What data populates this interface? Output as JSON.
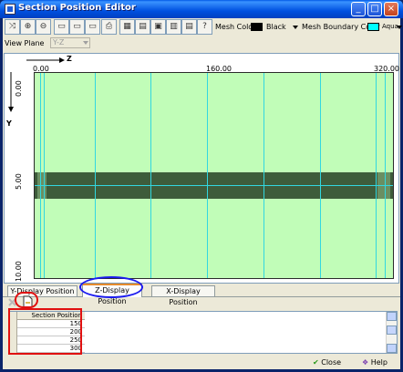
{
  "window": {
    "title": "Section Position Editor"
  },
  "toolbar": {
    "mesh_color_label": "Mesh Color",
    "mesh_color_value": "Black",
    "mesh_color_hex": "#000000",
    "boundary_color_label": "Mesh Boundary Color",
    "boundary_color_value": "Aqua",
    "boundary_color_hex": "#00ffff",
    "icons": [
      "pointer-icon",
      "zoom-in-icon",
      "zoom-out-icon",
      "zoom-fit-icon",
      "view-a-icon",
      "view-b-icon",
      "print-icon",
      "view-c-icon",
      "view-d-icon",
      "view-e-icon",
      "view-f-icon",
      "view-g-icon",
      "export-icon",
      "help-icon"
    ]
  },
  "view_plane": {
    "label": "View Plane",
    "value": "Y-Z"
  },
  "canvas": {
    "z_axis_label": "Z",
    "y_axis_label": "Y",
    "z_ticks": [
      "0.00",
      "160.00",
      "320.00"
    ],
    "y_ticks": [
      "0.00",
      "5.00",
      "10.00"
    ],
    "fill_color": "#c1fdb8",
    "member_color": "#3e5c3b",
    "section_line_color": "#32d7e0"
  },
  "tabs": [
    {
      "label": "Y-Display Position",
      "active": false
    },
    {
      "label": "Z-Display Position",
      "active": true
    },
    {
      "label": "X-Display Position",
      "active": false
    }
  ],
  "grid": {
    "header": "Section Position",
    "rows": [
      "150",
      "200",
      "250",
      "300"
    ]
  },
  "buttons": {
    "close": "Close",
    "help": "Help"
  }
}
